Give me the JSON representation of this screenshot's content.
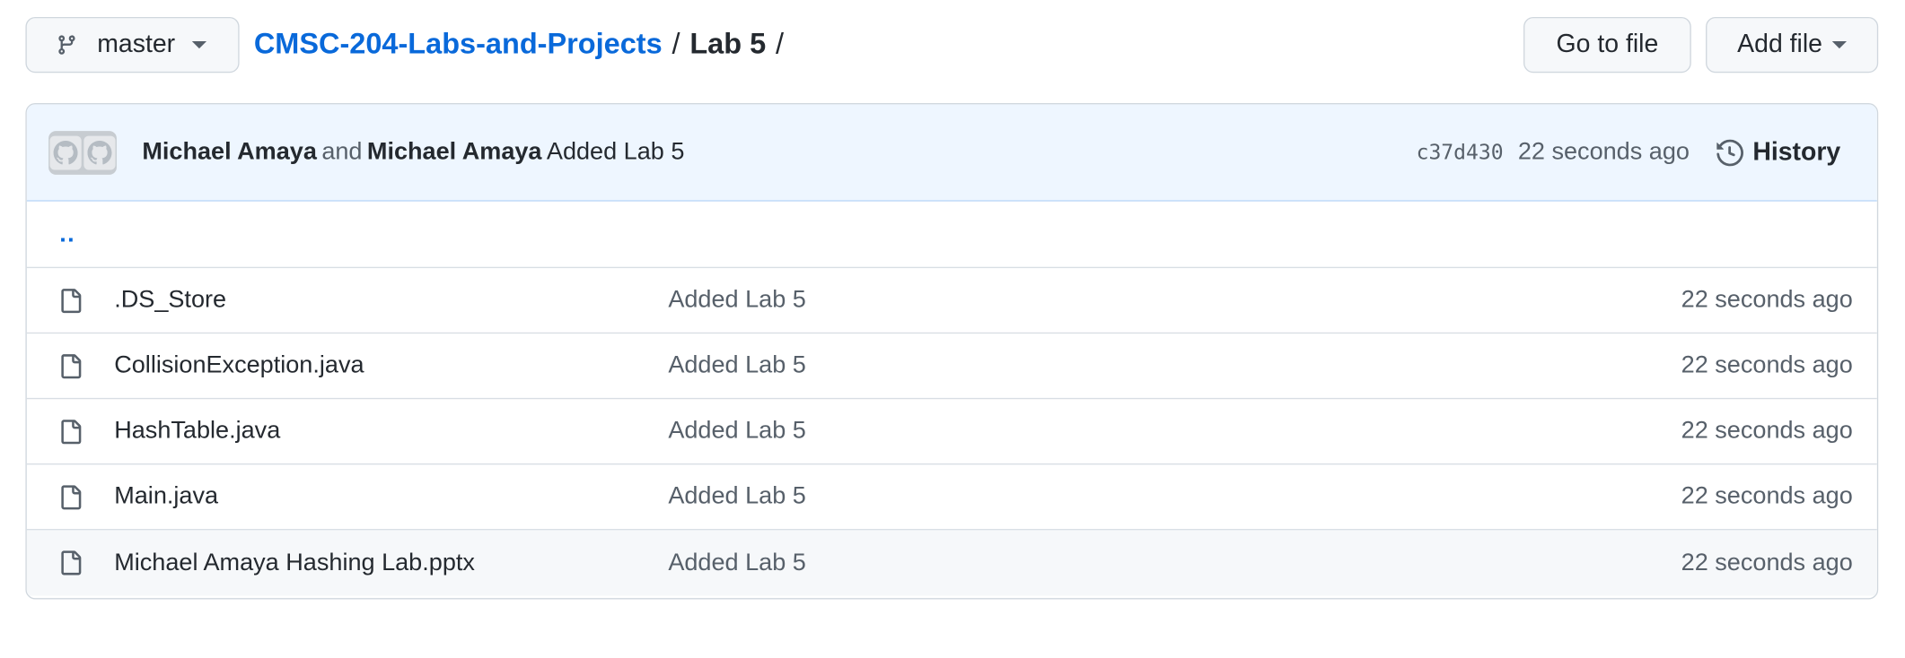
{
  "toolbar": {
    "branch": "master",
    "go_to_file": "Go to file",
    "add_file": "Add file"
  },
  "breadcrumb": {
    "repo": "CMSC-204-Labs-and-Projects",
    "separator": "/",
    "dir": "Lab 5",
    "trailing": "/"
  },
  "commit": {
    "author1": "Michael Amaya",
    "and_text": "and",
    "author2": "Michael Amaya",
    "message": "Added Lab 5",
    "sha": "c37d430",
    "time": "22 seconds ago",
    "history_label": "History"
  },
  "parent_dir": "..",
  "files": [
    {
      "name": ".DS_Store",
      "message": "Added Lab 5",
      "age": "22 seconds ago"
    },
    {
      "name": "CollisionException.java",
      "message": "Added Lab 5",
      "age": "22 seconds ago"
    },
    {
      "name": "HashTable.java",
      "message": "Added Lab 5",
      "age": "22 seconds ago"
    },
    {
      "name": "Main.java",
      "message": "Added Lab 5",
      "age": "22 seconds ago"
    },
    {
      "name": "Michael Amaya Hashing Lab.pptx",
      "message": "Added Lab 5",
      "age": "22 seconds ago"
    }
  ],
  "colors": {
    "link": "#0969da",
    "commit_bg": "#eef6ff",
    "border": "#d0d7de"
  }
}
